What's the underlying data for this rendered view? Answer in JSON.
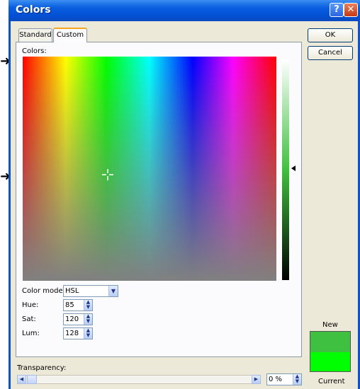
{
  "window": {
    "title": "Colors",
    "help_icon": "?",
    "close_icon": "✕"
  },
  "tabs": [
    {
      "label": "Standard",
      "active": false
    },
    {
      "label": "Custom",
      "active": true
    }
  ],
  "buttons": {
    "ok": "OK",
    "cancel": "Cancel"
  },
  "colors_label": "Colors:",
  "color_model": {
    "label": "Color model:",
    "value": "HSL"
  },
  "fields": {
    "hue": {
      "label": "Hue:",
      "value": "85"
    },
    "sat": {
      "label": "Sat:",
      "value": "120"
    },
    "lum": {
      "label": "Lum:",
      "value": "128"
    }
  },
  "transparency": {
    "label": "Transparency:",
    "value": "0 %",
    "level": 0
  },
  "preview": {
    "new_label": "New",
    "current_label": "Current",
    "new_color": "#40c040",
    "current_color": "#00ff00"
  },
  "colors": {
    "title_bar": "#0a5fe0",
    "dialog_bg": "#ece9d8",
    "tab_highlight": "#f5a620"
  }
}
